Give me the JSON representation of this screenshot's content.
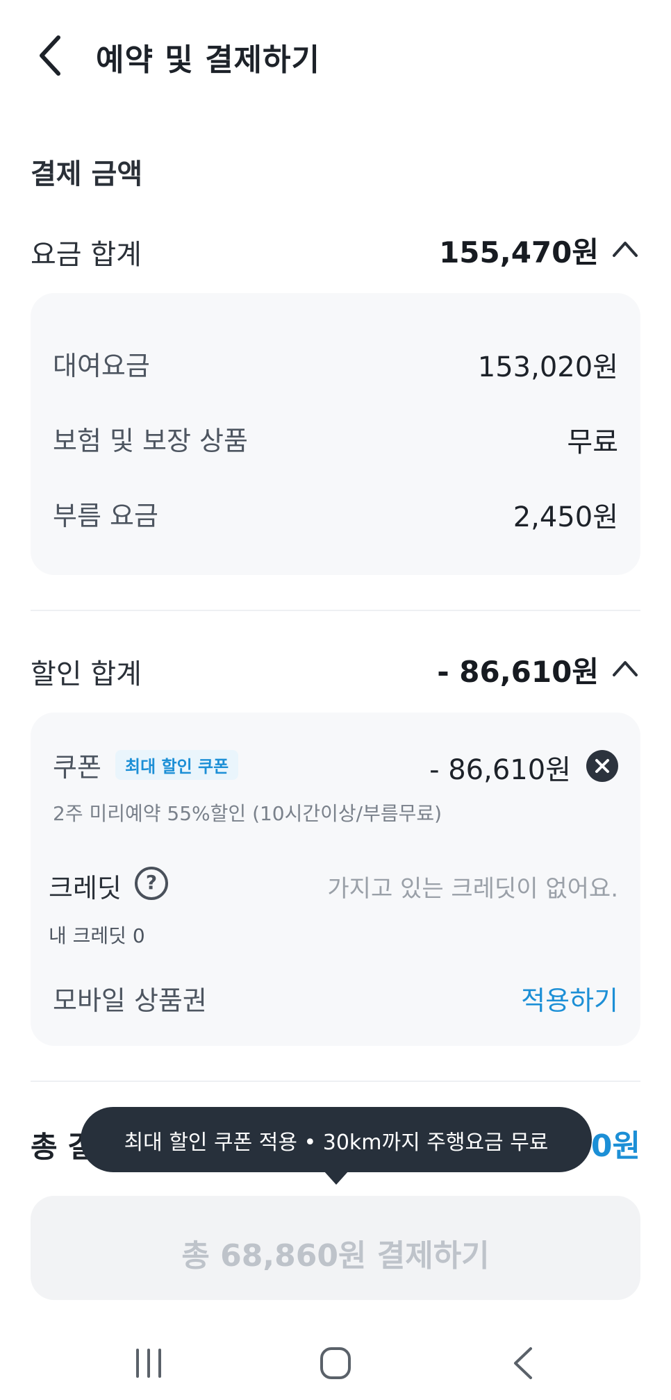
{
  "header": {
    "title": "예약 및 결제하기"
  },
  "payment_section": {
    "title": "결제 금액"
  },
  "fare_total": {
    "label": "요금 합계",
    "amount": "155,470원",
    "items": [
      {
        "label": "대여요금",
        "value": "153,020원"
      },
      {
        "label": "보험 및 보장 상품",
        "value": "무료"
      },
      {
        "label": "부름 요금",
        "value": "2,450원"
      }
    ]
  },
  "discount_total": {
    "label": "할인 합계",
    "amount": "- 86,610원",
    "coupon": {
      "label": "쿠폰",
      "badge": "최대 할인 쿠폰",
      "amount": "- 86,610원",
      "description": "2주 미리예약 55%할인 (10시간이상/부름무료)"
    },
    "credit": {
      "label": "크레딧",
      "help_glyph": "?",
      "empty_message": "가지고 있는 크레딧이 없어요.",
      "my_credit": "내 크레딧 0"
    },
    "voucher": {
      "label": "모바일 상품권",
      "action": "적용하기"
    }
  },
  "total": {
    "label": "총 결",
    "amount": "0원"
  },
  "tooltip": {
    "text": "최대 할인 쿠폰 적용 • 30km까지 주행요금 무료"
  },
  "pay_button": {
    "label": "총 68,860원 결제하기"
  },
  "colors": {
    "accent": "#1c8fd6",
    "dark": "#27303b",
    "card_bg": "#f7f8fa"
  },
  "icons": [
    "back-arrow-icon",
    "chevron-up-icon",
    "close-circle-icon",
    "question-circle-icon",
    "recent-apps-icon",
    "home-icon",
    "back-icon"
  ]
}
